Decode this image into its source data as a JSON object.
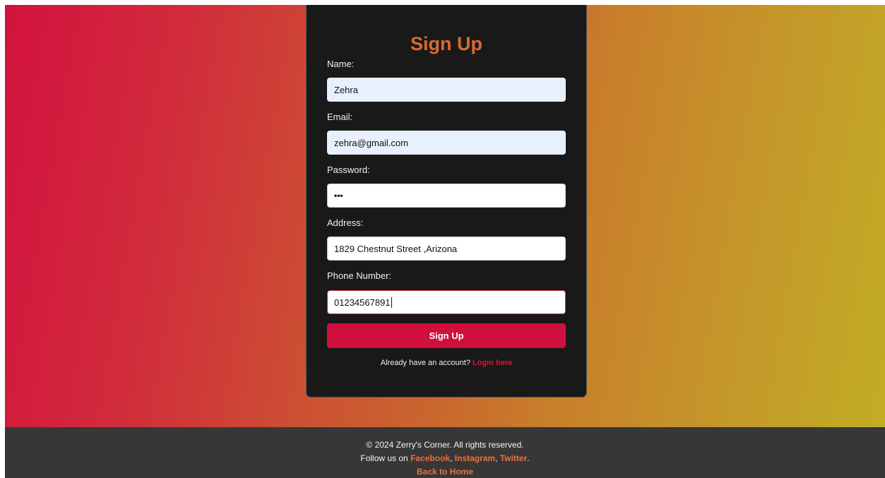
{
  "signup_form": {
    "title": "Sign Up",
    "fields": {
      "name": {
        "label": "Name:",
        "value": "Zehra"
      },
      "email": {
        "label": "Email:",
        "value": "zehra@gmail.com"
      },
      "password": {
        "label": "Password:",
        "masked_value": "•••"
      },
      "address": {
        "label": "Address:",
        "value": "1829 Chestnut Street ,Arizona"
      },
      "phone": {
        "label": "Phone Number:",
        "value": "01234567891"
      }
    },
    "submit_label": "Sign Up",
    "login_prompt": "Already have an account?",
    "login_link": "Login here"
  },
  "footer": {
    "copyright": "© 2024 Zerry's Corner. All rights reserved.",
    "follow_prefix": "Follow us on",
    "facebook": "Facebook",
    "separator_1": ",",
    "instagram": "Instagram",
    "separator_2": ",",
    "twitter": "Twitter",
    "follow_suffix": ".",
    "back_home": "Back to Home"
  },
  "colors": {
    "accent_title": "#d96a2e",
    "button": "#d00f3d",
    "login_link": "#d4173f",
    "footer_link": "#e8703f",
    "card_bg": "#191919",
    "footer_bg": "#373737"
  }
}
